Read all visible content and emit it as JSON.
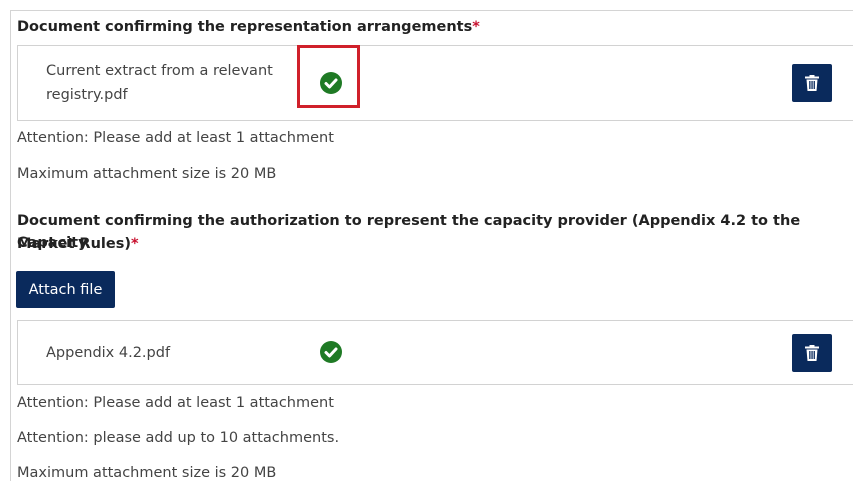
{
  "section1": {
    "title": "Document confirming the representation arrangements",
    "required_mark": "*",
    "file": {
      "name_line1": "Current extract from a relevant",
      "name_line2": "registry.pdf",
      "status_icon": "check-circle-icon",
      "delete_icon": "trash-icon"
    },
    "notes": [
      "Attention: Please add at least 1 attachment",
      "Maximum attachment size is 20 MB"
    ]
  },
  "section2": {
    "title_line1": "Document confirming the authorization to represent the capacity provider (Appendix 4.2 to the Capacity",
    "title_line2": "Market Rules)",
    "required_mark": "*",
    "attach_button": "Attach file",
    "file": {
      "name": "Appendix 4.2.pdf",
      "status_icon": "check-circle-icon",
      "delete_icon": "trash-icon"
    },
    "notes": [
      "Attention: Please add at least 1 attachment",
      "Attention: please add up to 10 attachments.",
      "Maximum attachment size is 20 MB"
    ]
  },
  "colors": {
    "primary_button": "#0a2a5c",
    "success": "#1f7a25",
    "required": "#c8102e",
    "highlight_box": "#d0202a"
  }
}
